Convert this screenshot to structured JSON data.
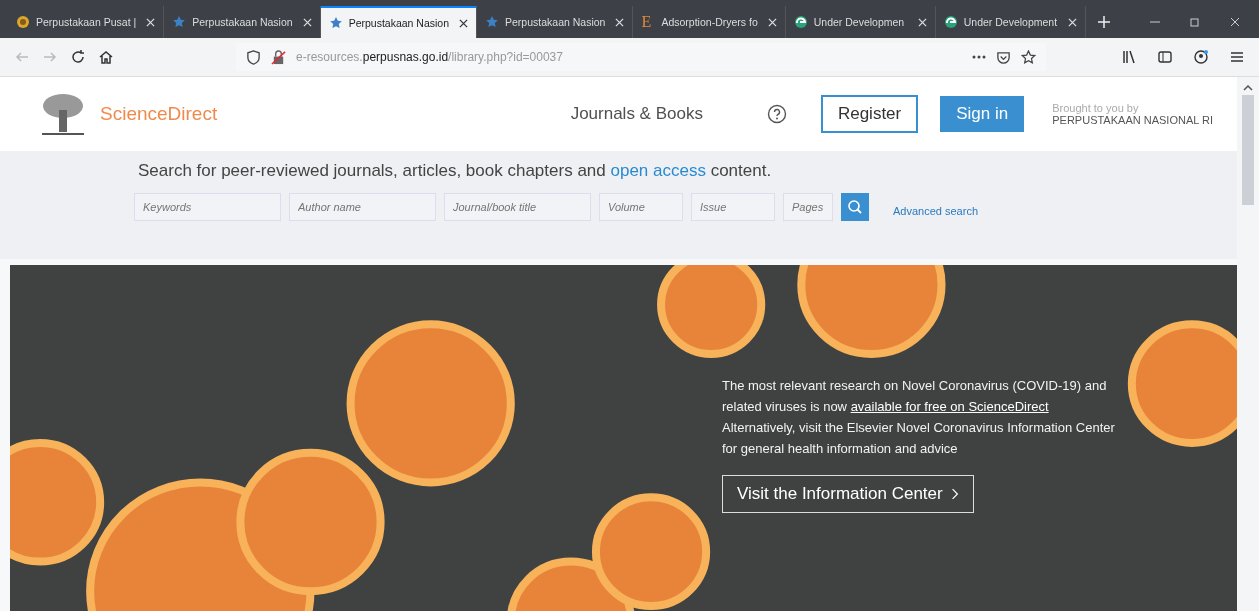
{
  "tabs": [
    {
      "title": "Perpustakaan Pusat |",
      "kind": "emblem",
      "selected": false
    },
    {
      "title": "Perpustakaan Nasion",
      "kind": "star",
      "selected": false
    },
    {
      "title": "Perpustakaan Nasion",
      "kind": "star",
      "selected": true
    },
    {
      "title": "Perpustakaan Nasion",
      "kind": "star",
      "selected": false
    },
    {
      "title": "Adsorption-Dryers fo",
      "kind": "letter",
      "icon_text": "E",
      "selected": false
    },
    {
      "title": "Under Developmen",
      "kind": "globe",
      "selected": false
    },
    {
      "title": "Under Development",
      "kind": "globe",
      "selected": false
    }
  ],
  "address_bar": {
    "url_prefix": "e-resources.",
    "url_domain": "perpusnas.go.id",
    "url_path": "/library.php?id=00037"
  },
  "header": {
    "logo_text": "ScienceDirect",
    "nav_link": "Journals & Books",
    "register": "Register",
    "sign_in": "Sign in",
    "brought_by": "Brought to you by",
    "institution": "PERPUSTAKAAN NASIONAL RI"
  },
  "search": {
    "intro_before": "Search for peer-reviewed journals, articles, book chapters and",
    "intro_link": "open access",
    "intro_after": "content.",
    "fields": [
      {
        "placeholder": "Keywords"
      },
      {
        "placeholder": "Author name"
      },
      {
        "placeholder": "Journal/book title"
      },
      {
        "placeholder": "Volume"
      },
      {
        "placeholder": "Issue"
      },
      {
        "placeholder": "Pages"
      }
    ],
    "advanced": "Advanced search"
  },
  "banner": {
    "text_before": "The most relevant research on Novel Coronavirus (COVID-19) and related viruses is now",
    "link": "available for free on ScienceDirect",
    "text_after": "Alternatively, visit the Elsevier Novel Coronavirus Information Center for general health information and advice",
    "button": "Visit the Information Center"
  }
}
